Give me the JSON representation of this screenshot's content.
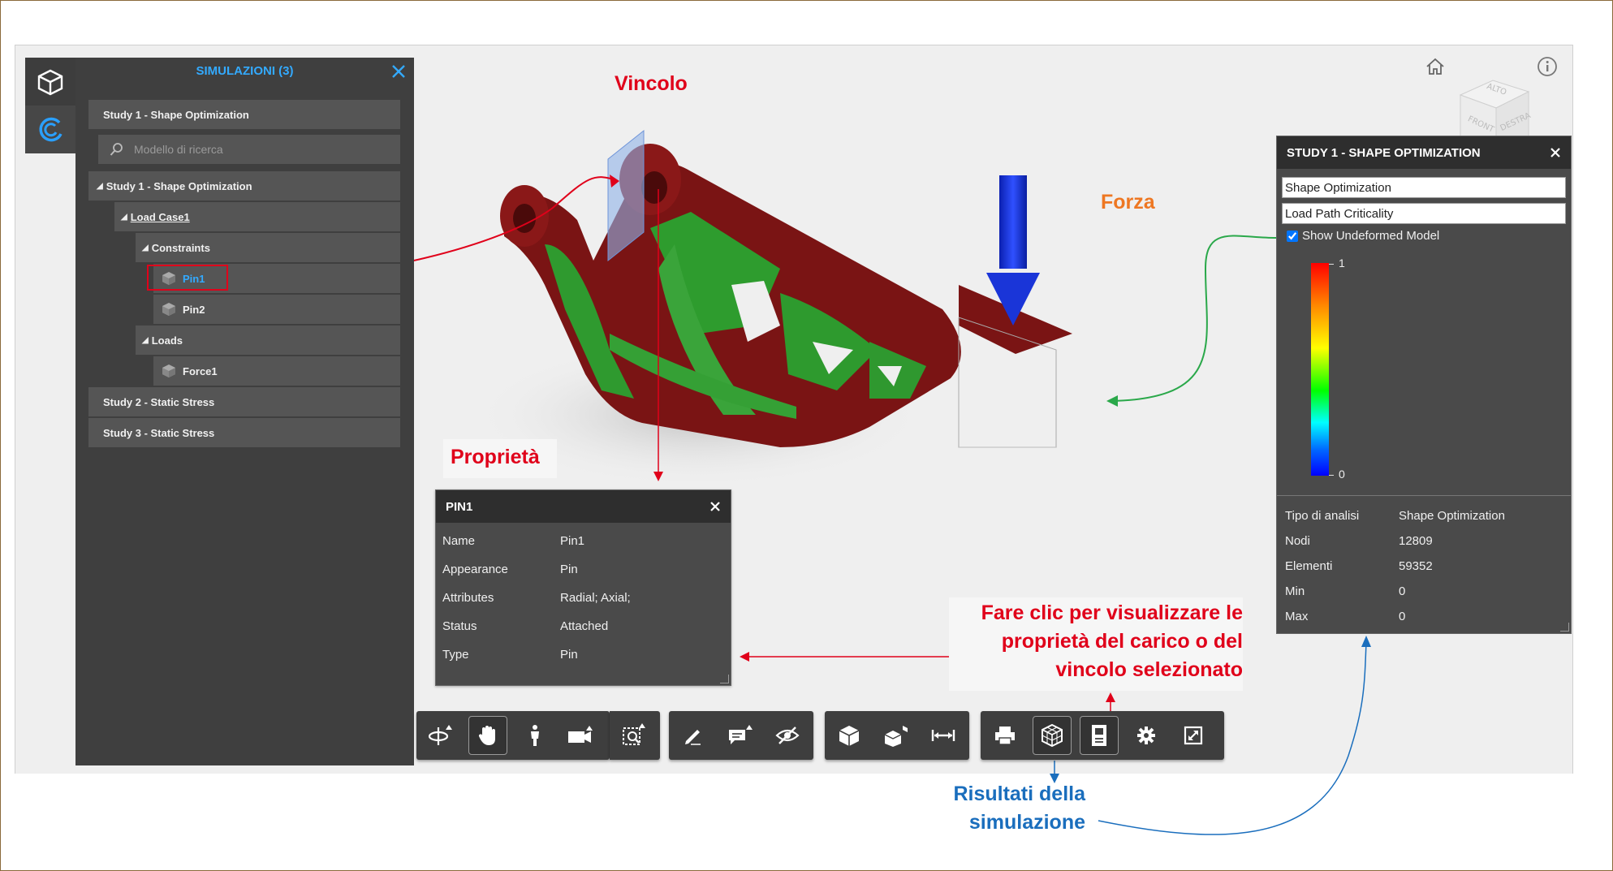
{
  "sidebar": {
    "title": "SIMULAZIONI (3)",
    "search_placeholder": "Modello di ricerca",
    "items": [
      {
        "label": "Study 1 - Shape Optimization"
      },
      {
        "label": "Study 1 - Shape Optimization"
      },
      {
        "label": "Load Case1"
      },
      {
        "label": "Constraints"
      },
      {
        "label": "Pin1"
      },
      {
        "label": "Pin2"
      },
      {
        "label": "Loads"
      },
      {
        "label": "Force1"
      },
      {
        "label": "Study 2 - Static Stress"
      },
      {
        "label": "Study 3 - Static Stress"
      }
    ]
  },
  "annotations": {
    "vincolo": "Vincolo",
    "forza": "Forza",
    "proprieta": "Proprietà",
    "click_hint_1": "Fare clic per visualizzare le",
    "click_hint_2": "proprietà del carico o del",
    "click_hint_3": "vincolo selezionato",
    "results_1": "Risultati della",
    "results_2": "simulazione"
  },
  "properties": {
    "title": "PIN1",
    "rows": [
      {
        "key": "Name",
        "value": "Pin1"
      },
      {
        "key": "Appearance",
        "value": "Pin"
      },
      {
        "key": "Attributes",
        "value": "Radial; Axial;"
      },
      {
        "key": "Status",
        "value": "Attached"
      },
      {
        "key": "Type",
        "value": "Pin"
      }
    ]
  },
  "study_panel": {
    "title": "STUDY 1 - SHAPE OPTIMIZATION",
    "result_type": "Shape Optimization",
    "result_view": "Load Path Criticality",
    "show_undeformed_label": "Show Undeformed Model",
    "show_undeformed_checked": true,
    "legend_max": "1",
    "legend_min": "0",
    "info": [
      {
        "key": "Tipo di analisi",
        "value": "Shape Optimization"
      },
      {
        "key": "Nodi",
        "value": "12809"
      },
      {
        "key": "Elementi",
        "value": "59352"
      },
      {
        "key": "Min",
        "value": "0"
      },
      {
        "key": "Max",
        "value": "0"
      }
    ]
  },
  "viewcube": {
    "top": "ALTO",
    "front": "FRONT",
    "right": "DESTRA"
  },
  "colors": {
    "accent": "#33aaff",
    "annotation_red": "#e0001a",
    "annotation_orange": "#ee7722",
    "annotation_blue": "#1a6ebd",
    "panel": "#4a4a4a",
    "panel_header": "#2e2e2e"
  }
}
